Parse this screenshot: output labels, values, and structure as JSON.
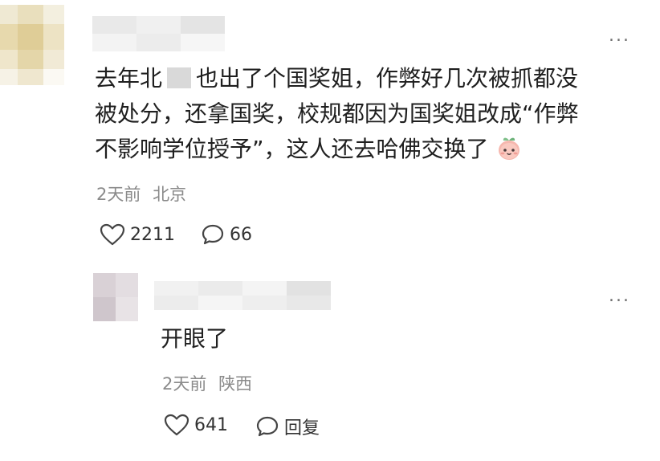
{
  "comment": {
    "text_line1_a": "去年北",
    "text_line1_b": "也出了个国奖姐，作弊好几次被抓都没",
    "text_line2": "被处分，还拿国奖，校规都因为国奖姐改成“作弊",
    "text_line3": "不影响学位授予”，这人还去哈佛交换了",
    "emoji": "peach-face-emoji",
    "time": "2天前",
    "location": "北京",
    "likes": "2211",
    "replies": "66",
    "more": "..."
  },
  "reply": {
    "text": "开眼了",
    "time": "2天前",
    "location": "陕西",
    "likes": "641",
    "reply_label": "回复",
    "more": "..."
  }
}
